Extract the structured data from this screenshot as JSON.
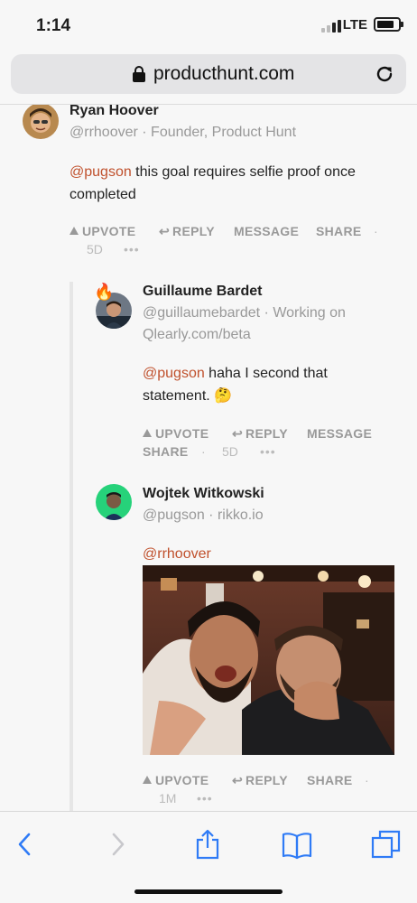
{
  "status_bar": {
    "time": "1:14",
    "network": "LTE"
  },
  "browser": {
    "url": "producthunt.com"
  },
  "comments": [
    {
      "author": "Ryan Hoover",
      "handle_line": "@rrhoover · Founder, Product Hunt",
      "mention": "@pugson",
      "text": " this goal requires selfie proof once completed",
      "actions": {
        "upvote": "UPVOTE",
        "reply": "REPLY",
        "message": "MESSAGE",
        "share": "SHARE"
      },
      "separator": "·",
      "age": "5D",
      "more": "•••"
    },
    {
      "author": "Guillaume Bardet",
      "handle_line_1": "@guillaumebardet · Working on",
      "handle_line_2": "Qlearly.com/beta",
      "mention": "@pugson",
      "text_line_1": " haha I second that",
      "text_line_2": "statement. 🤔",
      "actions": {
        "upvote": "UPVOTE",
        "reply": "REPLY",
        "message": "MESSAGE",
        "share": "SHARE"
      },
      "separator": "·",
      "age": "5D",
      "more": "•••"
    },
    {
      "author": "Wojtek Witkowski",
      "handle_line": "@pugson · rikko.io",
      "mention": "@rrhoover",
      "actions": {
        "upvote": "UPVOTE",
        "reply": "REPLY",
        "share": "SHARE"
      },
      "separator": "·",
      "age": "1M",
      "more": "•••"
    }
  ],
  "colors": {
    "mention": "#c0512d",
    "ios_blue": "#2f7bf6",
    "muted": "#999999"
  },
  "toolbar_icons": [
    "back-icon",
    "forward-icon",
    "share-icon",
    "bookmarks-icon",
    "tabs-icon"
  ]
}
